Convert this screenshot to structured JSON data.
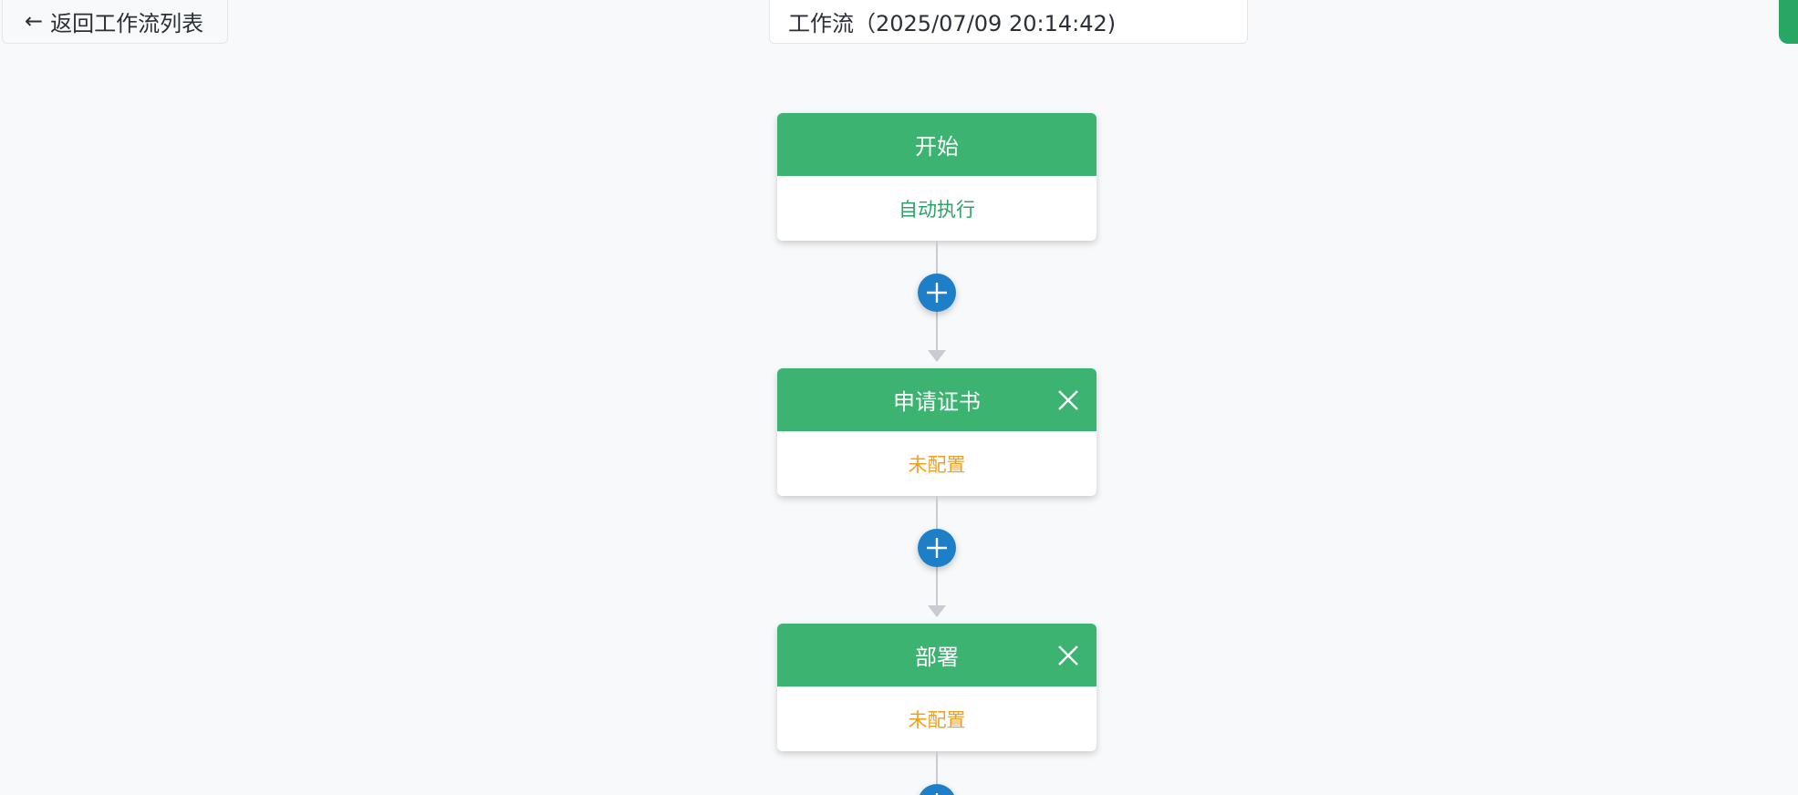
{
  "toolbar": {
    "back_label": "返回工作流列表",
    "back_icon": "arrow-left-icon"
  },
  "header": {
    "title": "工作流（2025/07/09 20:14:42)"
  },
  "colors": {
    "node_header": "#3cb371",
    "add_button": "#1e7fc9",
    "status_auto": "#2ea366",
    "status_unconfigured": "#f0a020",
    "corner_tab": "#27a862"
  },
  "flow": {
    "nodes": [
      {
        "title": "开始",
        "status": "自动执行",
        "status_type": "auto",
        "closable": false
      },
      {
        "title": "申请证书",
        "status": "未配置",
        "status_type": "unconfigured",
        "closable": true
      },
      {
        "title": "部署",
        "status": "未配置",
        "status_type": "unconfigured",
        "closable": true
      }
    ],
    "add_icon": "plus-circle-icon",
    "close_icon": "close-icon"
  }
}
